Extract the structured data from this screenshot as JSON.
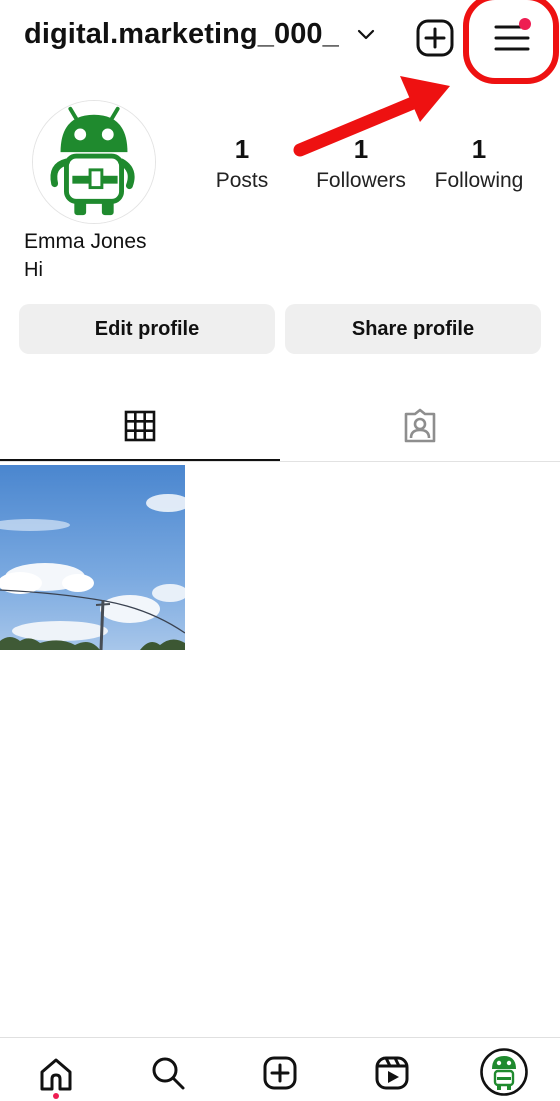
{
  "header": {
    "username": "digital.marketing_000_",
    "icons": [
      "chevron-down-icon",
      "plus-square-icon",
      "hamburger-menu-icon"
    ],
    "notification_color": "#ee1d52",
    "annotation_color": "#ee1111"
  },
  "profile": {
    "stats": [
      {
        "value": "1",
        "label": "Posts"
      },
      {
        "value": "1",
        "label": "Followers"
      },
      {
        "value": "1",
        "label": "Following"
      }
    ],
    "name": "Emma Jones",
    "bio": "Hi"
  },
  "actions": {
    "edit_label": "Edit profile",
    "share_label": "Share profile"
  },
  "tabs": [
    {
      "icon": "grid-icon",
      "active": true
    },
    {
      "icon": "tagged-person-icon",
      "active": false
    }
  ],
  "posts_count": 1,
  "bottom_nav": [
    {
      "icon": "home-icon",
      "active": true
    },
    {
      "icon": "search-icon"
    },
    {
      "icon": "create-post-icon"
    },
    {
      "icon": "reels-icon"
    },
    {
      "icon": "profile-avatar-icon"
    }
  ]
}
